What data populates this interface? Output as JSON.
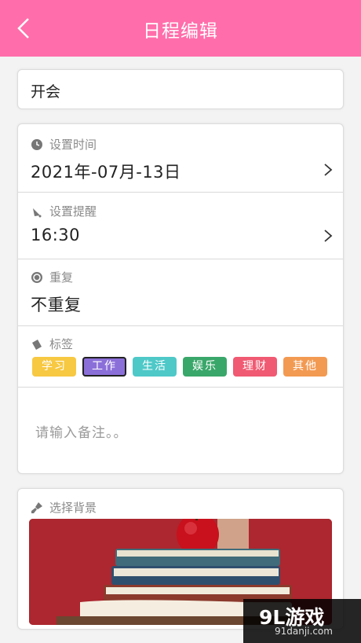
{
  "header": {
    "title": "日程编辑"
  },
  "title_field": {
    "value": "开会"
  },
  "time": {
    "label": "设置时间",
    "value": "2021年-07月-13日"
  },
  "reminder": {
    "label": "设置提醒",
    "value": "16:30"
  },
  "repeat": {
    "label": "重复",
    "value": "不重复"
  },
  "tags": {
    "label": "标签",
    "items": [
      {
        "label": "学习",
        "color": "#f7c842"
      },
      {
        "label": "工作",
        "color": "#8b6fd9",
        "selected": true
      },
      {
        "label": "生活",
        "color": "#4fc8c8"
      },
      {
        "label": "娱乐",
        "color": "#3aa76a"
      },
      {
        "label": "理财",
        "color": "#f05a72"
      },
      {
        "label": "其他",
        "color": "#f39a52"
      }
    ]
  },
  "notes": {
    "placeholder": "请输入备注。。"
  },
  "background": {
    "label": "选择背景"
  },
  "watermark": {
    "main": "9L游戏",
    "sub": "91danji.com"
  },
  "colors": {
    "accent": "#ff6eaa"
  }
}
